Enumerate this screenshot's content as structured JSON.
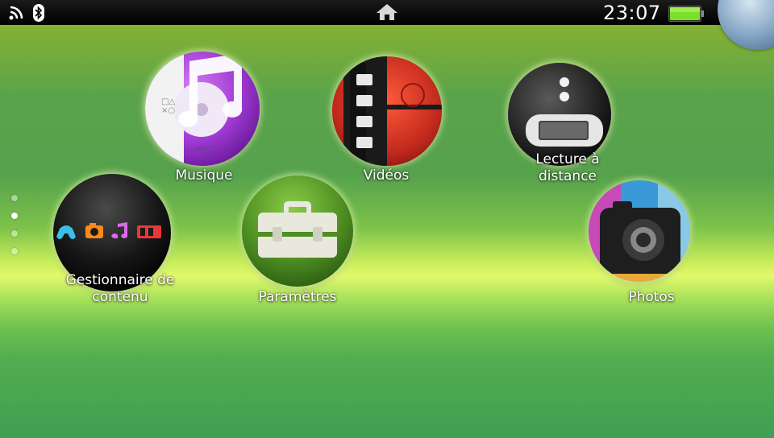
{
  "status": {
    "time": "23:07",
    "icons": [
      "wifi-icon",
      "bluetooth-icon",
      "home-icon",
      "battery-icon"
    ]
  },
  "apps": [
    {
      "name": "music",
      "label": "Musique",
      "icon": "music-note-icon"
    },
    {
      "name": "videos",
      "label": "Vidéos",
      "icon": "film-strip-icon"
    },
    {
      "name": "remote-play",
      "label": "Lecture à\ndistance",
      "icon": "handheld-console-icon"
    },
    {
      "name": "content-manager",
      "label": "Gestionnaire de\ncontenu",
      "icon": "content-manager-icon"
    },
    {
      "name": "settings",
      "label": "Paramètres",
      "icon": "toolbox-icon"
    },
    {
      "name": "photos",
      "label": "Photos",
      "icon": "camera-icon"
    }
  ],
  "pages": {
    "count": 4,
    "active": 2
  },
  "colors": {
    "statusbar": "#000000",
    "background_top": "#8fb52a",
    "background_band": "#e2f86c",
    "background_bottom": "#3f9f52",
    "music": "#a23bd6",
    "videos": "#c83a2a",
    "settings": "#4f8f22"
  }
}
